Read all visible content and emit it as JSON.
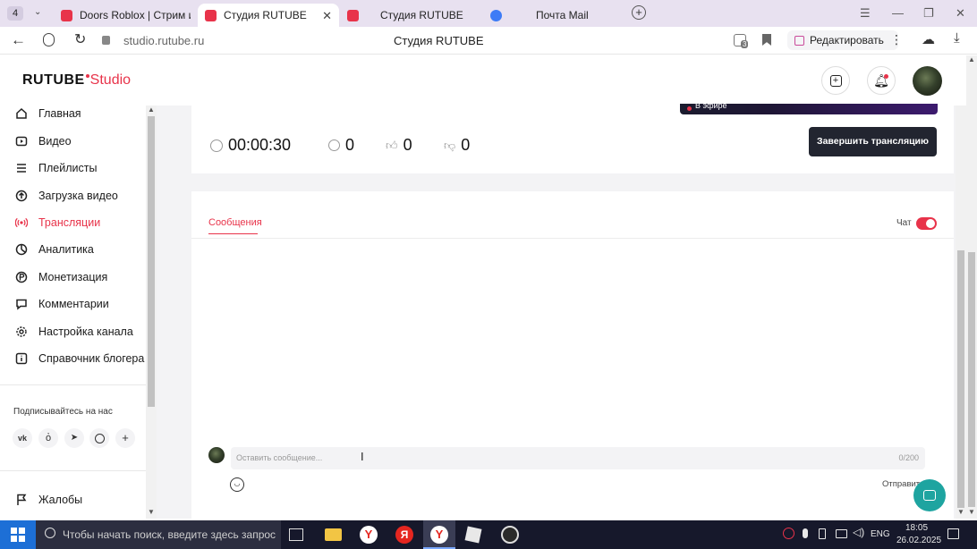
{
  "browser": {
    "tab_count": "4",
    "tabs": [
      {
        "title": "Doors Roblox | Стрим игр",
        "color": "#e8334a"
      },
      {
        "title": "Студия RUTUBE",
        "color": "#e8334a"
      },
      {
        "title": "Студия RUTUBE",
        "color": "#e8334a"
      },
      {
        "title": "Почта Mail",
        "color": "#3d7bf6"
      }
    ],
    "url": "studio.rutube.ru",
    "page_title": "Студия RUTUBE",
    "edit_label": "Редактировать",
    "bookmark_count": "3"
  },
  "app": {
    "logo_main": "RUTUBE",
    "logo_sub": "Studio",
    "accent": "#e8334a"
  },
  "sidebar": {
    "items": [
      {
        "label": "Главная",
        "icon": "home-icon"
      },
      {
        "label": "Видео",
        "icon": "video-icon"
      },
      {
        "label": "Плейлисты",
        "icon": "playlist-icon"
      },
      {
        "label": "Загрузка видео",
        "icon": "upload-icon"
      },
      {
        "label": "Трансляции",
        "icon": "broadcast-icon",
        "active": true
      },
      {
        "label": "Аналитика",
        "icon": "analytics-icon"
      },
      {
        "label": "Монетизация",
        "icon": "monetization-icon"
      },
      {
        "label": "Комментарии",
        "icon": "comments-icon"
      },
      {
        "label": "Настройка канала",
        "icon": "gear-icon"
      },
      {
        "label": "Справочник блогера",
        "icon": "info-icon"
      }
    ],
    "subscribe_label": "Подписывайтесь на нас",
    "socials": [
      "vk-icon",
      "ok-icon",
      "telegram-icon",
      "viber-icon",
      "more-icon"
    ],
    "complaints_label": "Жалобы"
  },
  "stream": {
    "on_air_label": "В эфире",
    "timer": "00:00:30",
    "viewers": "0",
    "likes": "0",
    "dislikes": "0",
    "end_button": "Завершить трансляцию"
  },
  "chat": {
    "tab_label": "Сообщения",
    "toggle_label": "Чат",
    "toggle_on": true,
    "input_placeholder": "Оставить сообщение...",
    "char_counter": "0/200",
    "send_label": "Отправить"
  },
  "taskbar": {
    "search_placeholder": "Чтобы начать поиск, введите здесь запрос",
    "lang": "ENG",
    "time": "18:05",
    "date": "26.02.2025"
  }
}
